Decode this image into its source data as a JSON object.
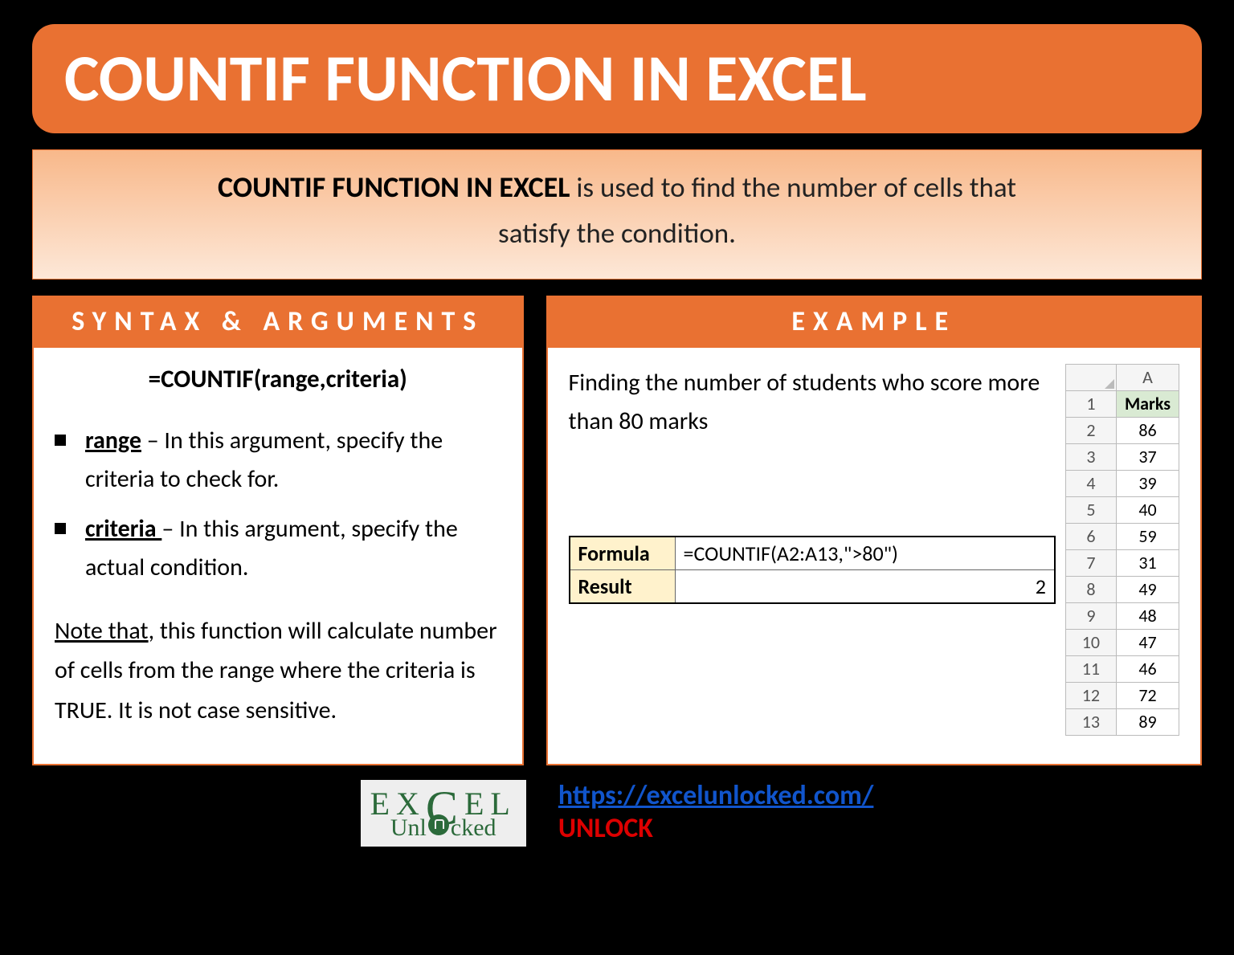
{
  "title": "COUNTIF FUNCTION IN EXCEL",
  "description": {
    "bold": "COUNTIF FUNCTION IN EXCEL",
    "rest1": " is used to find the number of cells that",
    "line2": "satisfy the condition."
  },
  "syntax": {
    "header": "SYNTAX & ARGUMENTS",
    "formula": "=COUNTIF(range,criteria)",
    "args": [
      {
        "name": "range",
        "desc": " – In this argument, specify the criteria to check for."
      },
      {
        "name": "criteria ",
        "desc": "– In this argument, specify the actual condition."
      }
    ],
    "note_label": "Note that",
    "note_rest": ", this function will calculate number of cells from the range where the criteria is TRUE. It is not case sensitive."
  },
  "example": {
    "header": "EXAMPLE",
    "desc": "Finding the number of students who score more than 80 marks",
    "formula_label": "Formula",
    "formula_value": "=COUNTIF(A2:A13,\">80\")",
    "result_label": "Result",
    "result_value": "2",
    "marks_col": "A",
    "marks_header": "Marks",
    "marks_rows": [
      {
        "n": "1",
        "v": "Marks"
      },
      {
        "n": "2",
        "v": "86"
      },
      {
        "n": "3",
        "v": "37"
      },
      {
        "n": "4",
        "v": "39"
      },
      {
        "n": "5",
        "v": "40"
      },
      {
        "n": "6",
        "v": "59"
      },
      {
        "n": "7",
        "v": "31"
      },
      {
        "n": "8",
        "v": "49"
      },
      {
        "n": "9",
        "v": "48"
      },
      {
        "n": "10",
        "v": "47"
      },
      {
        "n": "11",
        "v": "46"
      },
      {
        "n": "12",
        "v": "72"
      },
      {
        "n": "13",
        "v": "89"
      }
    ]
  },
  "footer": {
    "logo_top1": "EX",
    "logo_top2": "EL",
    "logo_bot": "Unl   cked",
    "link": "https://excelunlocked.com/",
    "unlock": "UNLOCK"
  }
}
